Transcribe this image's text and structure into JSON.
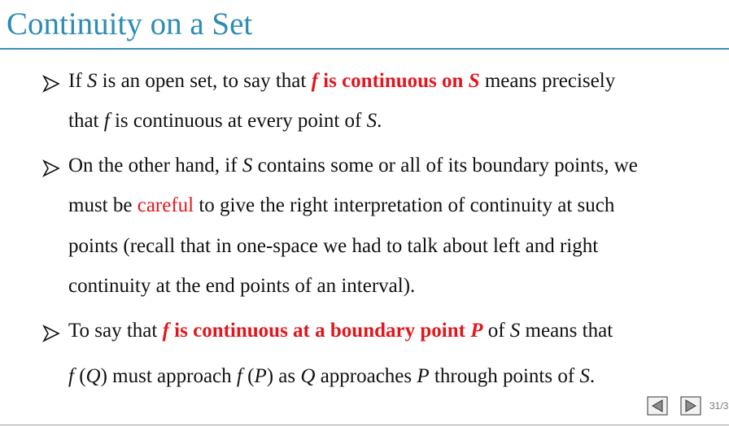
{
  "slide": {
    "title": "Continuity on a Set"
  },
  "bullets": [
    {
      "lines": [
        [
          {
            "t": "If ",
            "s": ""
          },
          {
            "t": "S",
            "s": "it"
          },
          {
            "t": " is an open set, to say that ",
            "s": ""
          },
          {
            "t": "f",
            "s": "red bi"
          },
          {
            "t": " is continuous on ",
            "s": "red b"
          },
          {
            "t": "S",
            "s": "red bi"
          },
          {
            "t": " means precisely",
            "s": ""
          }
        ],
        [
          {
            "t": "that ",
            "s": ""
          },
          {
            "t": "f",
            "s": "it"
          },
          {
            "t": " is continuous at every point of ",
            "s": ""
          },
          {
            "t": "S",
            "s": "it"
          },
          {
            "t": ".",
            "s": ""
          }
        ]
      ]
    },
    {
      "lines": [
        [
          {
            "t": "On the other hand, if ",
            "s": ""
          },
          {
            "t": "S",
            "s": "it"
          },
          {
            "t": " contains some or all of its boundary points, we",
            "s": ""
          }
        ],
        [
          {
            "t": "must be ",
            "s": ""
          },
          {
            "t": "careful",
            "s": "red"
          },
          {
            "t": " to give the right interpretation of continuity at such",
            "s": ""
          }
        ],
        [
          {
            "t": "points (recall that in one-space we had to talk about left and right",
            "s": ""
          }
        ],
        [
          {
            "t": "continuity at the end points of an interval).",
            "s": ""
          }
        ]
      ]
    },
    {
      "lines": [
        [
          {
            "t": "To say that ",
            "s": ""
          },
          {
            "t": "f",
            "s": "red bi"
          },
          {
            "t": " is continuous at a boundary point ",
            "s": "red b"
          },
          {
            "t": "P",
            "s": "red bi"
          },
          {
            "t": " of ",
            "s": ""
          },
          {
            "t": "S",
            "s": "it"
          },
          {
            "t": " means that",
            "s": ""
          }
        ],
        [
          {
            "t": "f",
            "s": "it"
          },
          {
            "t": " (",
            "s": ""
          },
          {
            "t": "Q",
            "s": "it"
          },
          {
            "t": ") must approach ",
            "s": ""
          },
          {
            "t": "f",
            "s": "it"
          },
          {
            "t": " (",
            "s": ""
          },
          {
            "t": "P",
            "s": "it"
          },
          {
            "t": ") as ",
            "s": ""
          },
          {
            "t": "Q",
            "s": "it"
          },
          {
            "t": " approaches ",
            "s": ""
          },
          {
            "t": "P",
            "s": "it"
          },
          {
            "t": " through points of ",
            "s": ""
          },
          {
            "t": "S",
            "s": "it"
          },
          {
            "t": ".",
            "s": ""
          }
        ]
      ]
    }
  ],
  "footer": {
    "prev_icon": "triangle-left-icon",
    "next_icon": "triangle-right-icon",
    "page_number": "31/3"
  },
  "colors": {
    "title": "#2e8bb5",
    "title_rule": "#3a8fb8",
    "emphasis": "#e3161d",
    "text": "#111111"
  }
}
